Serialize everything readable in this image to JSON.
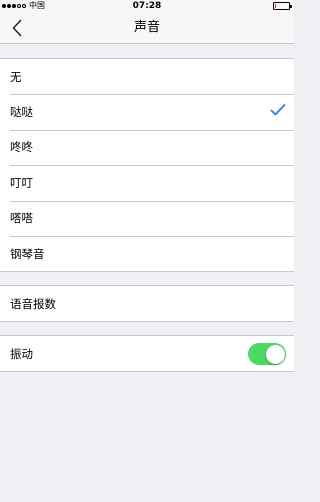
{
  "status_bar": {
    "carrier": "中国",
    "time": "07:28",
    "signal_filled": 3,
    "signal_total": 5,
    "battery_level": 0.1,
    "battery_color": "#e0302a"
  },
  "nav": {
    "title": "声音",
    "back_icon": "chevron-left-icon"
  },
  "sounds": {
    "items": [
      {
        "label": "无"
      },
      {
        "label": "哒哒",
        "selected": true
      },
      {
        "label": "咚咚"
      },
      {
        "label": "叮叮"
      },
      {
        "label": "嗒嗒"
      },
      {
        "label": "钢琴音"
      }
    ],
    "check_color": "#3478f6"
  },
  "voice": {
    "label": "语音报数"
  },
  "vibration": {
    "label": "振动",
    "enabled": true,
    "toggle_color": "#4cd964"
  }
}
